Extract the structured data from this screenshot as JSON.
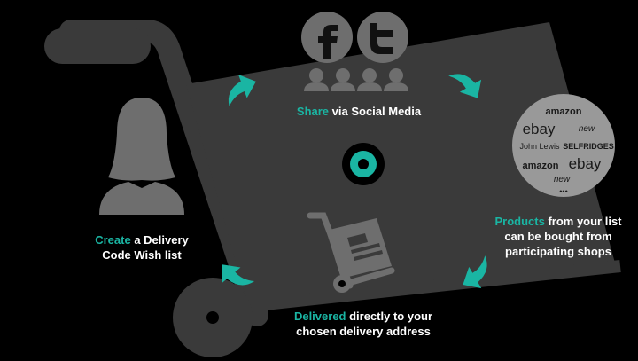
{
  "colors": {
    "accent": "#1ab5a3",
    "panel": "#3a3a3a",
    "icon_grey": "#6e6e6e",
    "text": "#ffffff"
  },
  "icons": [
    "facebook-icon",
    "twitter-icon",
    "people-icon",
    "woman-avatar-icon",
    "hand-truck-icon",
    "curved-arrow-icon",
    "logo-ring-icon"
  ],
  "steps": {
    "share": {
      "highlight": "Share",
      "text": " via Social Media"
    },
    "create": {
      "highlight": "Create",
      "text": " a Delivery",
      "line2": "Code Wish list"
    },
    "products": {
      "highlight": "Products",
      "text": " from your list",
      "line2": "can be bought from",
      "line3": "participating shops"
    },
    "delivered": {
      "highlight": "Delivered",
      "text": " directly to your",
      "line2": "chosen delivery address"
    }
  },
  "shops": {
    "amazon1": "amazon",
    "ebay1": "ebay",
    "new1": "new",
    "johnlewis": "John Lewis",
    "selfridges": "SELFRIDGES",
    "amazon2": "amazon",
    "ebay2": "ebay",
    "new2": "new",
    "more": "•••"
  }
}
